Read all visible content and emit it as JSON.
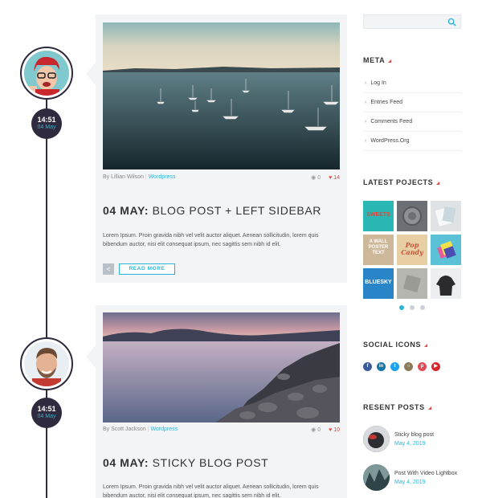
{
  "posts": [
    {
      "time": "14:51",
      "date_badge": "04 May",
      "author": "By Lillian Wilson",
      "category": "Wordpress",
      "comments": "0",
      "likes": "14",
      "title_bold": "04 MAY:",
      "title_rest": "BLOG POST + LEFT SIDEBAR",
      "excerpt": "Lorem Ipsum. Proin gravida nibh vel velit auctor aliquet. Aenean sollicitudin, lorem quis bibendum auctor, nisi elit consequat ipsum, nec sagittis sem nibh id elit.",
      "read_more": "READ MORE"
    },
    {
      "time": "14:51",
      "date_badge": "04 May",
      "author": "By Scott Jackson",
      "category": "Wordpress",
      "comments": "0",
      "likes": "10",
      "title_bold": "04 MAY:",
      "title_rest": "STICKY BLOG POST",
      "excerpt": "Lorem Ipsum. Proin gravida nibh vel velit auctor aliquet. Aenean sollicitudin, lorem quis bibendum auctor, nisi elit consequat ipsum, nec sagittis sem nibh id elit."
    }
  ],
  "sidebar": {
    "search_placeholder": "",
    "meta_title": "META",
    "meta_items": [
      "Log In",
      "Entries Feed",
      "Comments Feed",
      "WordPress.Org"
    ],
    "projects_title": "LATEST POJECTS",
    "projects": [
      "SWEETS",
      "",
      "",
      "A WALL POSTER TEXT",
      "Pop Candy",
      "",
      "BLUESKY",
      "",
      ""
    ],
    "social_title": "SOCIAL ICONS",
    "social_icons": [
      "facebook-icon",
      "linkedin-icon",
      "twitter-icon",
      "instagram-icon",
      "pinterest-icon",
      "youtube-icon"
    ],
    "recent_title": "RESENT POSTS",
    "recent_posts": [
      {
        "title": "Sticky blog post",
        "date": "May 4, 2019"
      },
      {
        "title": "Post With Video Lightbox",
        "date": "May 4, 2019"
      }
    ]
  },
  "colors": {
    "accent": "#29b6d6",
    "dark": "#2f2a3d",
    "like": "#e2483f"
  }
}
